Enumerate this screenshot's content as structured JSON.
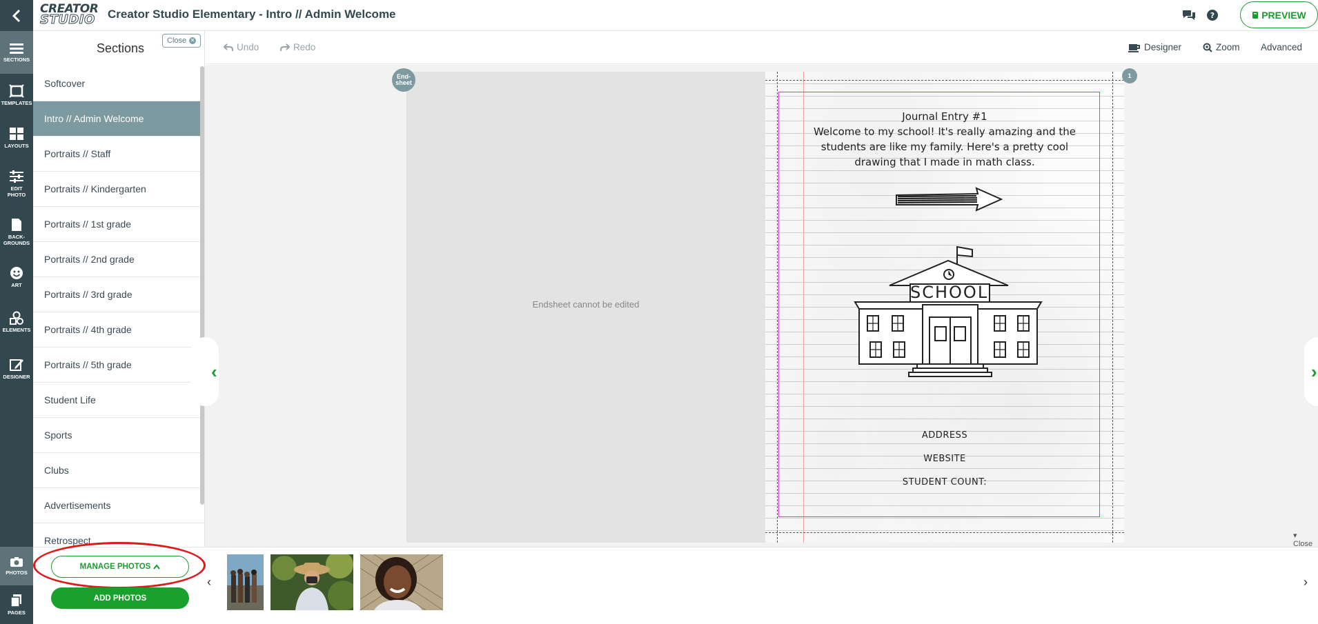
{
  "header": {
    "logo_line1": "CREATOR",
    "logo_line2": "STUDIO",
    "title": "Creator Studio Elementary - Intro // Admin Welcome",
    "preview_label": "PREVIEW"
  },
  "rail": {
    "items": [
      {
        "label": "SECTIONS",
        "icon": "sections-icon"
      },
      {
        "label": "TEMPLATES",
        "icon": "templates-icon"
      },
      {
        "label": "LAYOUTS",
        "icon": "layouts-icon"
      },
      {
        "label": "EDIT PHOTO",
        "icon": "edit-photo-icon"
      },
      {
        "label": "BACK-GROUNDS",
        "icon": "backgrounds-icon"
      },
      {
        "label": "ART",
        "icon": "art-icon"
      },
      {
        "label": "ELEMENTS",
        "icon": "elements-icon"
      },
      {
        "label": "DESIGNER",
        "icon": "designer-icon"
      },
      {
        "label": "PHOTOS",
        "icon": "camera-icon"
      },
      {
        "label": "PAGES",
        "icon": "pages-icon"
      }
    ]
  },
  "sections": {
    "title": "Sections",
    "close_label": "Close",
    "items": [
      {
        "label": "Softcover"
      },
      {
        "label": "Intro // Admin Welcome"
      },
      {
        "label": "Portraits // Staff"
      },
      {
        "label": "Portraits // Kindergarten"
      },
      {
        "label": "Portraits // 1st grade"
      },
      {
        "label": "Portraits // 2nd grade"
      },
      {
        "label": "Portraits // 3rd grade"
      },
      {
        "label": "Portraits // 4th grade"
      },
      {
        "label": "Portraits // 5th grade"
      },
      {
        "label": "Student Life"
      },
      {
        "label": "Sports"
      },
      {
        "label": "Clubs"
      },
      {
        "label": "Advertisements"
      },
      {
        "label": "Retrospect"
      }
    ],
    "active_index": 1
  },
  "toolbar": {
    "undo": "Undo",
    "redo": "Redo",
    "designer": "Designer",
    "zoom": "Zoom",
    "advanced": "Advanced"
  },
  "canvas": {
    "endsheet_badge": "End-sheet",
    "endsheet_message": "Endsheet cannot be edited",
    "page_number": "1",
    "journal_title": "Journal Entry #1",
    "journal_body": "Welcome to my school! It's really amazing and the students are like my family. Here's a pretty cool drawing that I made in math class.",
    "school_sign": "SCHOOL",
    "address": "ADDRESS",
    "website": "WEBSITE",
    "student_count": "STUDENT COUNT:"
  },
  "tray": {
    "manage_photos": "MANAGE PHOTOS",
    "add_photos": "ADD PHOTOS",
    "close_label": "Close"
  },
  "colors": {
    "rail": "#33474f",
    "accent_green": "#1a9c2f",
    "active_section": "#7e9aa1",
    "highlight_ring": "#e01818"
  }
}
